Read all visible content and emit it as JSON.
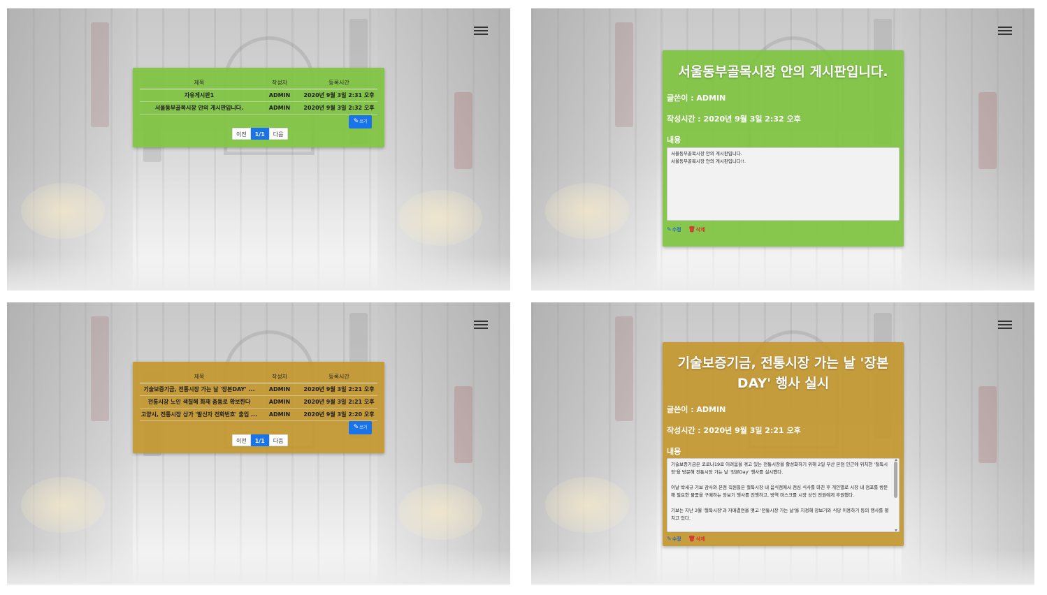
{
  "screens": {
    "board_green": {
      "columns": [
        "제목",
        "작성자",
        "등록시간"
      ],
      "rows": [
        [
          "자유게시판1",
          "ADMIN",
          "2020년 9월 3일 2:31 오후"
        ],
        [
          "서울동부골목시장 안의 게시판입니다.",
          "ADMIN",
          "2020년 9월 3일 2:32 오후"
        ]
      ],
      "write_label": "쓰기",
      "pager": {
        "prev": "이전",
        "current": "1/1",
        "next": "다음"
      }
    },
    "post_green": {
      "title": "서울동부골목시장 안의 게시판입니다.",
      "author_line": "글쓴이 : ADMIN",
      "time_line": "작성시간 : 2020년 9월 3일 2:32 오후",
      "content_label": "내용",
      "content_lines": [
        "서울동부골목시장 안의 게시판입니다.",
        "서울동부골목시장 안의 게시판입니다!!."
      ],
      "edit_label": "수정",
      "delete_label": "삭제"
    },
    "board_gold": {
      "columns": [
        "제목",
        "작성자",
        "등록시간"
      ],
      "rows": [
        [
          "기술보증기금, 전통시장 가는 날 '장본DAY' ...",
          "ADMIN",
          "2020년 9월 3일 2:21 오후"
        ],
        [
          "전통시장 노인 색칠해 화재 춤둠로 확보한다",
          "ADMIN",
          "2020년 9월 3일 2:21 오후"
        ],
        [
          "고양시, 전통시장 상가 '발신자 전화번호' 출입 ...",
          "ADMIN",
          "2020년 9월 3일 2:20 오후"
        ]
      ],
      "write_label": "쓰기",
      "pager": {
        "prev": "이전",
        "current": "1/1",
        "next": "다음"
      }
    },
    "post_gold": {
      "title": "기술보증기금, 전통시장 가는 날 '장본 DAY' 행사 실시",
      "author_line": "글쓴이 : ADMIN",
      "time_line": "작성시간 : 2020년 9월 3일 2:21 오후",
      "content_label": "내용",
      "content_paragraphs": [
        "기술보증기금은 코로나19로 어려움을 겪고 있는 전통시장을 활성화하기 위해 2일 부산 본점 인근에 위치한 '철독시장'을 방문해 전통시장 가는 날 '장본Day' 행사를 실시했다.",
        "이날 박세규 기보 감사와 본점 직원들은 철독시장 내 음식점에서 점심 식사를 마친 후 개인별로 시장 내 점포를 방문해 필요한 물품을 구매하는 장보기 행사를 진행하고, 방역 마스크를 시장 상인 전원에게 후원했다.",
        "기보는 지난 3월 '철독시장'과 자매결연을 맺고 '전통시장 가는 날'을 지정해 장보기와 식당 이용하기 등의 행사를 펼치고 있다."
      ],
      "edit_label": "수정",
      "delete_label": "삭제"
    }
  },
  "colors": {
    "green_card": "#80c442",
    "gold_card": "#c49830",
    "primary": "#1a73e8",
    "delete": "#d8312b"
  },
  "icons": {
    "menu": "hamburger-icon",
    "write": "pencil-icon",
    "edit": "edit-icon",
    "delete": "trash-icon"
  }
}
